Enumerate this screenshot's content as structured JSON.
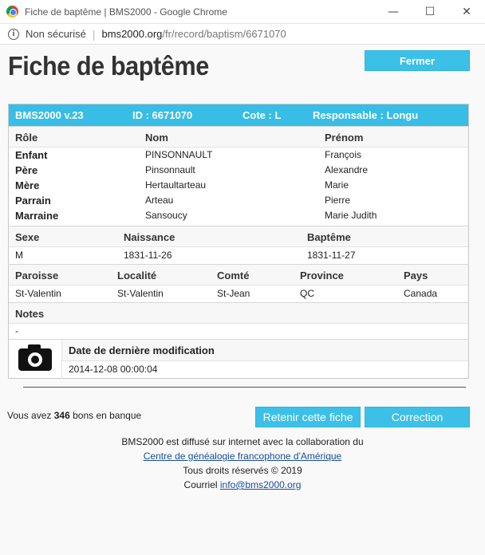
{
  "window": {
    "title": "Fiche de baptême | BMS2000 - Google Chrome",
    "minimize": "—",
    "maximize": "☐",
    "close": "✕"
  },
  "address": {
    "security": "Non sécurisé",
    "host": "bms2000.org",
    "path": "/fr/record/baptism/6671070"
  },
  "page": {
    "title": "Fiche de baptême",
    "close_button": "Fermer"
  },
  "record": {
    "header": {
      "version": "BMS2000 v.23",
      "id": "ID : 6671070",
      "cote": "Cote : L",
      "responsable": "Responsable : Longu"
    },
    "persons_headers": {
      "role": "Rôle",
      "nom": "Nom",
      "prenom": "Prénom"
    },
    "persons": [
      {
        "role": "Enfant",
        "nom": "PINSONNAULT",
        "prenom": "François"
      },
      {
        "role": "Père",
        "nom": "Pinsonnault",
        "prenom": "Alexandre"
      },
      {
        "role": "Mère",
        "nom": "Hertaultarteau",
        "prenom": "Marie"
      },
      {
        "role": "Parrain",
        "nom": "Arteau",
        "prenom": "Pierre"
      },
      {
        "role": "Marraine",
        "nom": "Sansoucy",
        "prenom": "Marie Judith"
      }
    ],
    "dates_headers": {
      "sexe": "Sexe",
      "naissance": "Naissance",
      "bapteme": "Baptême"
    },
    "dates": {
      "sexe": "M",
      "naissance": "1831-11-26",
      "bapteme": "1831-11-27"
    },
    "place_headers": {
      "paroisse": "Paroisse",
      "localite": "Localité",
      "comte": "Comté",
      "province": "Province",
      "pays": "Pays"
    },
    "place": {
      "paroisse": "St-Valentin",
      "localite": "St-Valentin",
      "comte": "St-Jean",
      "province": "QC",
      "pays": "Canada"
    },
    "notes_header": "Notes",
    "notes": "-",
    "modification_header": "Date de dernière modification",
    "modification": "2014-12-08 00:00:04"
  },
  "bank": {
    "prefix": "Vous avez",
    "count": "346",
    "suffix": "bons en banque"
  },
  "actions": {
    "retain": "Retenir cette fiche",
    "correction": "Correction"
  },
  "footer": {
    "line1": "BMS2000 est diffusé sur internet avec la collaboration du",
    "link": "Centre de généalogie francophone d'Amérique",
    "rights": "Tous droits réservés © 2019",
    "courriel_label": "Courriel",
    "email": "info@bms2000.org"
  }
}
